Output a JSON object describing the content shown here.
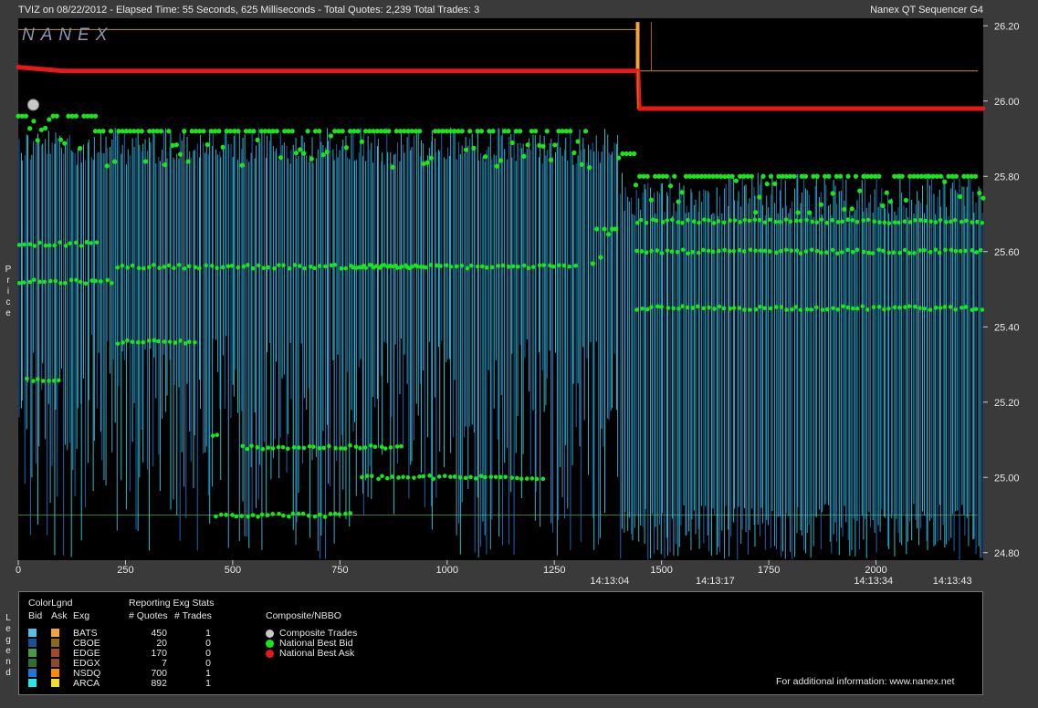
{
  "header": {
    "title": "TVIZ on 08/22/2012  -  Elapsed Time: 55 Seconds, 625 Milliseconds  -  Total Quotes: 2,239  Total Trades: 3",
    "app": "Nanex QT Sequencer G4",
    "watermark": "NANEX"
  },
  "side_labels": {
    "price": [
      "P",
      "r",
      "i",
      "c",
      "e"
    ],
    "legend": [
      "L",
      "e",
      "g",
      "e",
      "n",
      "d"
    ]
  },
  "chart_data": {
    "type": "line",
    "y_ticks": [
      "26.20",
      "26.00",
      "25.80",
      "25.60",
      "25.40",
      "25.20",
      "25.00",
      "24.80"
    ],
    "ylim": [
      24.78,
      26.22
    ],
    "x_ticks": [
      "0",
      "250",
      "500",
      "750",
      "1000",
      "1250",
      "1500",
      "1750",
      "2000"
    ],
    "xlim": [
      0,
      2250
    ],
    "time_labels": [
      {
        "x": 1379,
        "label": "14:13:04"
      },
      {
        "x": 1625,
        "label": "14:13:17"
      },
      {
        "x": 1994,
        "label": "14:13:34"
      },
      {
        "x": 2178,
        "label": "14:13:43"
      }
    ],
    "national_best_ask": [
      {
        "x": 0,
        "y": 26.09
      },
      {
        "x": 105,
        "y": 26.08
      },
      {
        "x": 1445,
        "y": 26.08
      },
      {
        "x": 1448,
        "y": 25.98
      },
      {
        "x": 2250,
        "y": 25.98
      }
    ],
    "national_best_bid_levels": [
      {
        "x0": 0,
        "x1": 180,
        "y": 25.96
      },
      {
        "x0": 180,
        "x1": 1340,
        "y": 25.92
      },
      {
        "x0": 1340,
        "x1": 1400,
        "y": 25.66
      },
      {
        "x0": 1400,
        "x1": 1440,
        "y": 25.86
      },
      {
        "x0": 1440,
        "x1": 2250,
        "y": 25.8
      }
    ],
    "composite_trades": [
      {
        "x": 35,
        "y": 25.99
      }
    ],
    "colors": {
      "nbb": "#19e619",
      "nbo": "#e81818",
      "trade": "#c8c8c8",
      "arca": "#22e8f0",
      "nsdq": "#1f78d8",
      "bats_bid": "#56bfe8",
      "edge_bid": "#4a9a3e",
      "bats_ask": "#f3a23c"
    }
  },
  "legend": {
    "color_legend_title": "ColorLgnd",
    "col_bid": "Bid",
    "col_ask": "Ask",
    "col_exg": "Exg",
    "stats_title": "Reporting Exg Stats",
    "col_quotes": "# Quotes",
    "col_trades": "# Trades",
    "exchanges": [
      {
        "name": "BATS",
        "quotes": "450",
        "trades": "1",
        "bid_color": "#56bfe8",
        "ask_color": "#f3a23c"
      },
      {
        "name": "CBOE",
        "quotes": "20",
        "trades": "0",
        "bid_color": "#1a4f9e",
        "ask_color": "#8a6a1a"
      },
      {
        "name": "EDGE",
        "quotes": "170",
        "trades": "0",
        "bid_color": "#4a9a3e",
        "ask_color": "#a04a2a"
      },
      {
        "name": "EDGX",
        "quotes": "7",
        "trades": "0",
        "bid_color": "#2e6e2e",
        "ask_color": "#8a4a30"
      },
      {
        "name": "NSDQ",
        "quotes": "700",
        "trades": "1",
        "bid_color": "#1f78d8",
        "ask_color": "#ff8c00"
      },
      {
        "name": "ARCA",
        "quotes": "892",
        "trades": "1",
        "bid_color": "#22e8f0",
        "ask_color": "#f0e020"
      }
    ],
    "composite_title": "Composite/NBBO",
    "composite_items": [
      {
        "label": "Composite Trades",
        "color": "#c8c8c8"
      },
      {
        "label": "National Best Bid",
        "color": "#19e619"
      },
      {
        "label": "National Best Ask",
        "color": "#e81818"
      }
    ],
    "footer": "For additional information: www.nanex.net"
  }
}
